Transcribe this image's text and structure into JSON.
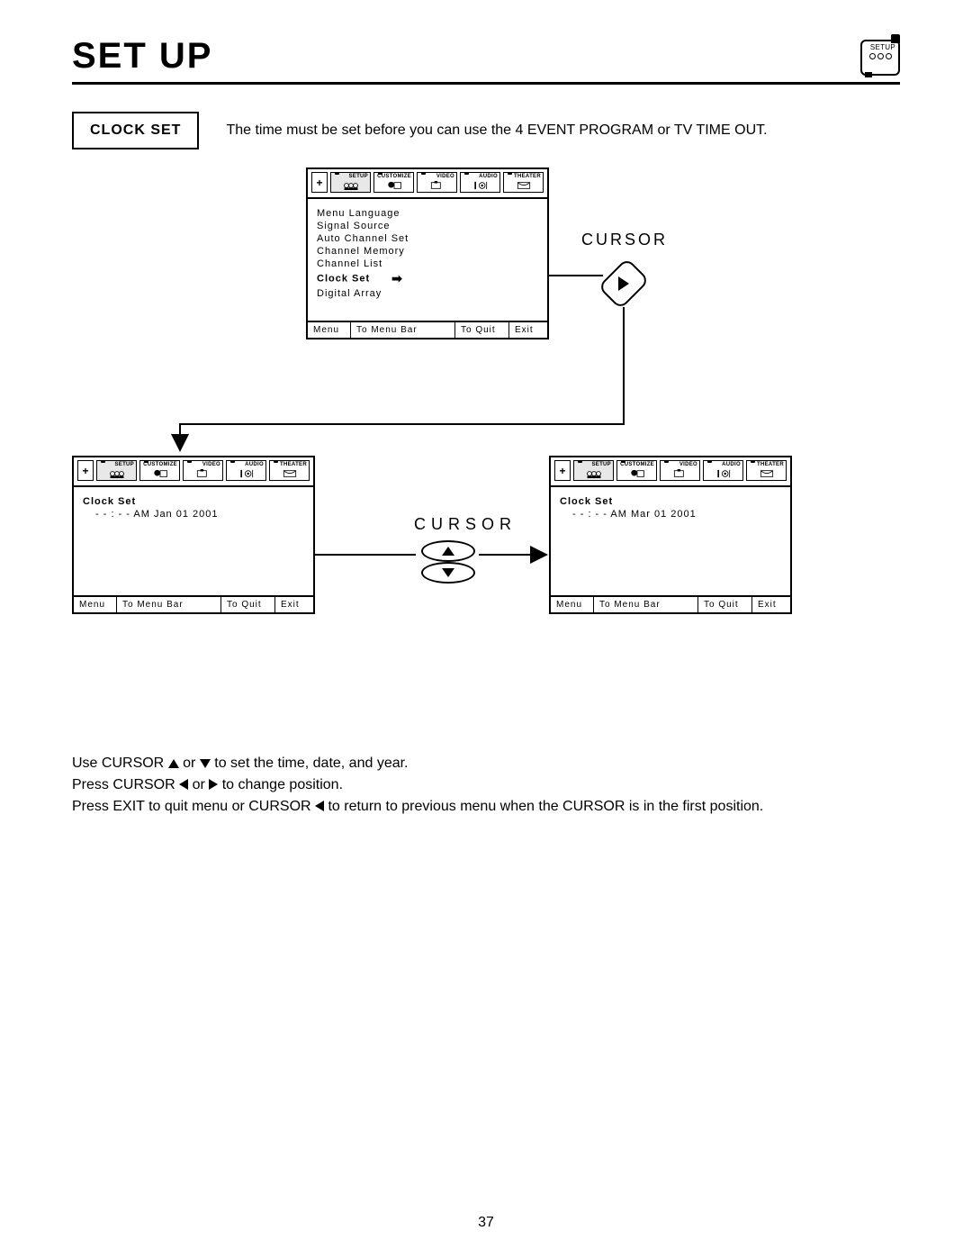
{
  "header": {
    "title": "SET UP",
    "badge_label": "SETUP"
  },
  "clockset": {
    "box_label": "CLOCK SET",
    "description": "The time must be set before you can use the 4 EVENT PROGRAM or TV TIME OUT."
  },
  "menubar_tabs": {
    "setup": "SETUP",
    "customize": "CUSTOMIZE",
    "video": "VIDEO",
    "audio": "AUDIO",
    "theater": "THEATER"
  },
  "osd_top": {
    "lines": {
      "menu_language": "Menu Language",
      "signal_source": "Signal Source",
      "auto_channel_set": "Auto Channel Set",
      "channel_memory": "Channel Memory",
      "channel_list": "Channel List",
      "clock_set": "Clock Set",
      "digital_array": "Digital Array"
    }
  },
  "osd_bl": {
    "title": "Clock Set",
    "value": "- - : - - AM Jan 01 2001"
  },
  "osd_br": {
    "title": "Clock Set",
    "value": "- - : - - AM Mar 01 2001"
  },
  "footer": {
    "menu": "Menu",
    "to_menu_bar": "To Menu Bar",
    "to_quit": "To Quit",
    "exit": "Exit"
  },
  "cursor_labels": {
    "top": "CURSOR",
    "mid": "CURSOR"
  },
  "instructions": {
    "l1a": "Use CURSOR ",
    "l1b": " or ",
    "l1c": " to set the time, date, and year.",
    "l2a": "Press CURSOR ",
    "l2b": " or ",
    "l2c": " to change position.",
    "l3a": "Press EXIT to quit menu or CURSOR ",
    "l3b": " to return to previous menu when the CURSOR is in the first position."
  },
  "page_number": "37"
}
